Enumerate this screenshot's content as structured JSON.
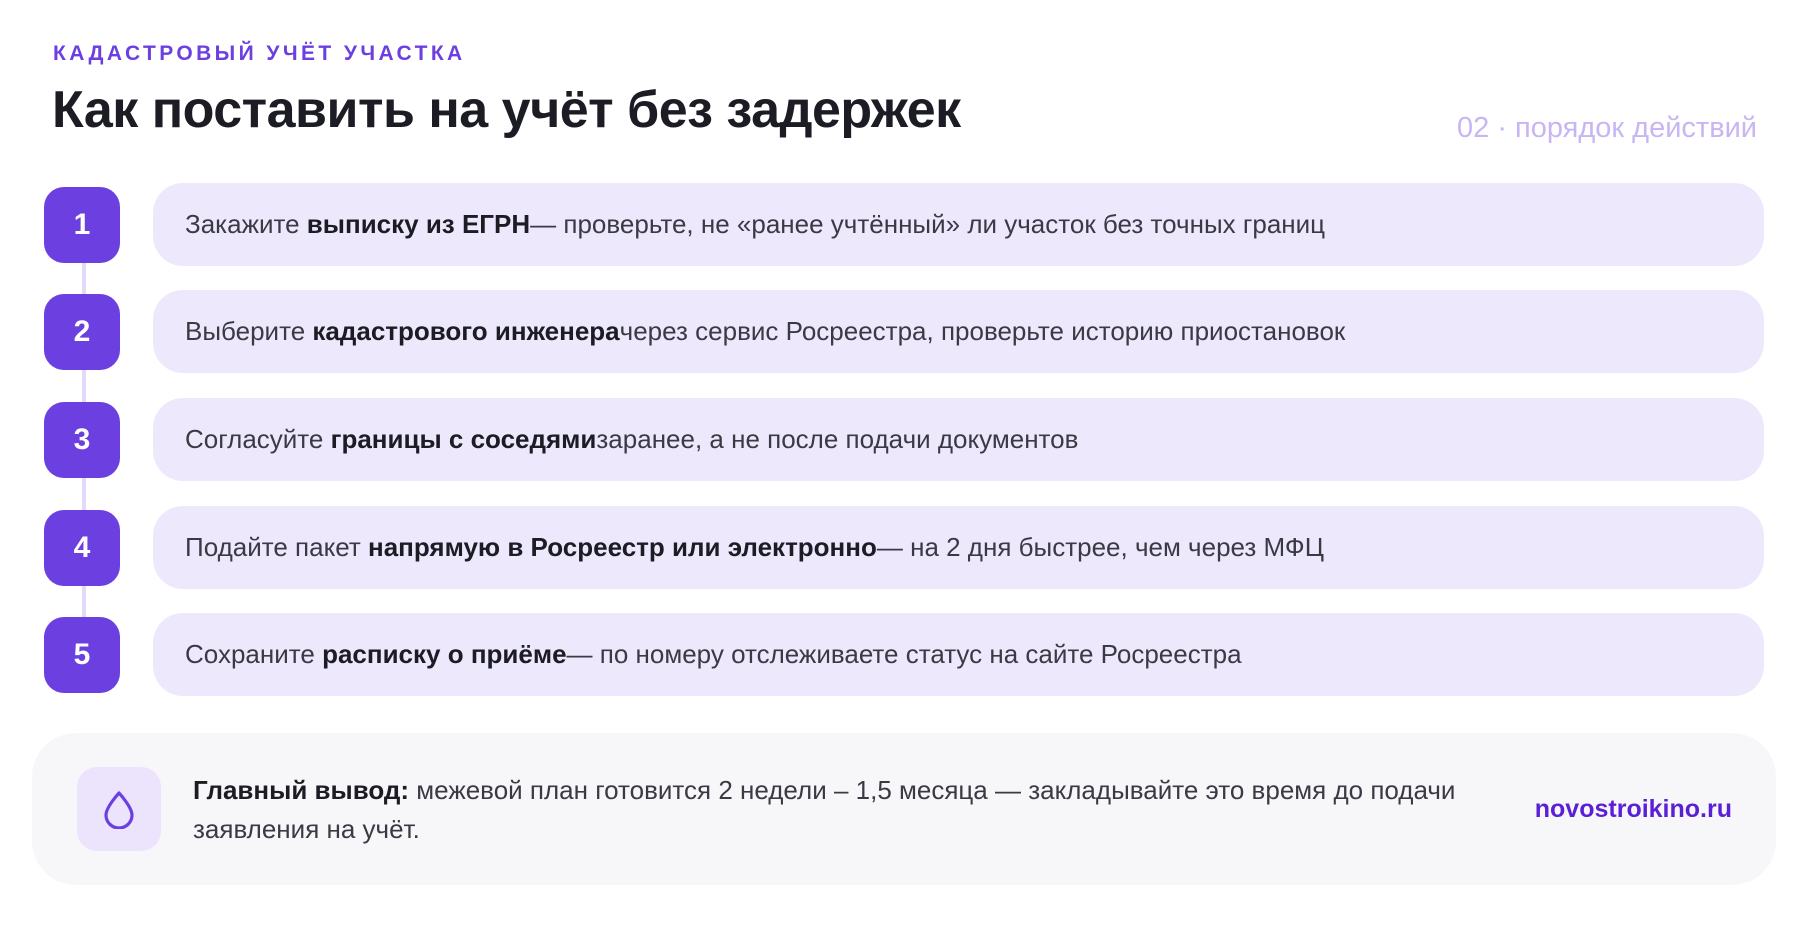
{
  "header": {
    "eyebrow": "КАДАСТРОВЫЙ УЧЁТ УЧАСТКА",
    "title": "Как поставить на учёт без задержек",
    "section_tag": "02 · порядок действий"
  },
  "steps": [
    {
      "number": "1",
      "pre": "Закажите ",
      "bold": "выписку из ЕГРН",
      "post": " — проверьте, не «ранее учтённый» ли участок без точных границ"
    },
    {
      "number": "2",
      "pre": "Выберите ",
      "bold": "кадастрового инженера",
      "post": " через сервис Росреестра, проверьте историю приостановок"
    },
    {
      "number": "3",
      "pre": "Согласуйте ",
      "bold": "границы с соседями",
      "post": " заранее, а не после подачи документов"
    },
    {
      "number": "4",
      "pre": "Подайте пакет ",
      "bold": "напрямую в Росреестр или электронно",
      "post": " — на 2 дня быстрее, чем через МФЦ"
    },
    {
      "number": "5",
      "pre": "Сохраните ",
      "bold": "расписку о приёме",
      "post": " — по номеру отслеживаете статус на сайте Росреестра"
    }
  ],
  "summary": {
    "icon": "drop-icon",
    "label": "Главный вывод:",
    "text": " межевой план готовится 2 недели – 1,5 месяца — закладывайте это время до подачи заявления на учёт.",
    "brand": "novostroikino.ru"
  },
  "colors": {
    "accent": "#6b3fe0",
    "card_bg": "#eee8fd",
    "section_tag": "#c8b6f4",
    "summary_bg": "#f7f7fa",
    "brand": "#5b1fd6"
  }
}
